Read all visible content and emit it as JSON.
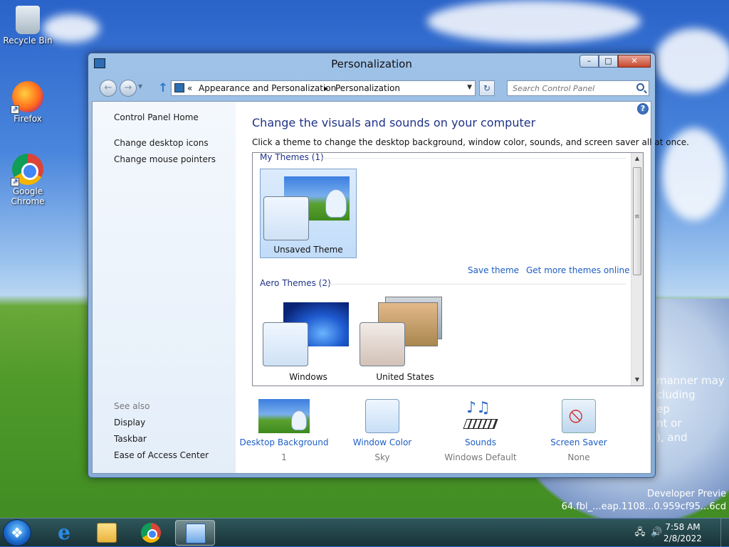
{
  "desktop": {
    "icons": [
      {
        "label": "Recycle Bin"
      },
      {
        "label": "Firefox"
      },
      {
        "label": "Google Chrome"
      }
    ],
    "wallpaper_text_lines": [
      "manner may",
      "cluding",
      "ep",
      "nt or",
      "), and"
    ],
    "developer_preview": [
      "Developer Previe",
      "64.fbl_...eap.1108...0.959cf95...6cd"
    ]
  },
  "window": {
    "title": "Personalization",
    "caption": {
      "minimize": "–",
      "maximize": "□",
      "close": "✕"
    },
    "nav": {
      "back": "←",
      "forward": "→",
      "dropdown": "▼",
      "up": "↑",
      "refresh": "↻",
      "breadcrumb_prefix": "«",
      "breadcrumb": [
        "Appearance and Personalization",
        "Personalization"
      ],
      "breadcrumb_sep": "▸",
      "address_dropdown": "▼",
      "search_placeholder": "Search Control Panel"
    },
    "left_pane": {
      "home": "Control Panel Home",
      "links": [
        "Change desktop icons",
        "Change mouse pointers"
      ],
      "see_also_title": "See also",
      "see_also": [
        "Display",
        "Taskbar",
        "Ease of Access Center"
      ]
    },
    "main": {
      "help": "?",
      "heading": "Change the visuals and sounds on your computer",
      "description": "Click a theme to change the desktop background, window color, sounds, and screen saver all at once.",
      "my_themes_header": "My Themes (1)",
      "my_themes": [
        {
          "label": "Unsaved Theme",
          "selected": true
        }
      ],
      "save_theme": "Save theme",
      "get_more_themes": "Get more themes online",
      "aero_themes_header": "Aero Themes (2)",
      "aero_themes": [
        {
          "label": "Windows"
        },
        {
          "label": "United States"
        }
      ],
      "scroll": {
        "up": "▲",
        "down": "▼",
        "grip": "≡"
      },
      "bottom": [
        {
          "link": "Desktop Background",
          "value": "1"
        },
        {
          "link": "Window Color",
          "value": "Sky"
        },
        {
          "link": "Sounds",
          "value": "Windows Default"
        },
        {
          "link": "Screen Saver",
          "value": "None"
        }
      ]
    }
  },
  "taskbar": {
    "ie_glyph": "e",
    "tray": {
      "network": "🖧",
      "volume": "🔊"
    },
    "clock": {
      "time": "7:58 AM",
      "date": "2/8/2022"
    }
  },
  "icon_names": [
    "recycle-bin-icon",
    "firefox-icon",
    "chrome-icon",
    "control-panel-icon",
    "search-icon",
    "help-icon",
    "ie-icon",
    "folder-icon",
    "network-icon",
    "volume-icon"
  ],
  "colors": {
    "link": "#1e5ec4",
    "heading": "#1e3287",
    "selection": "#c1dcf9"
  }
}
